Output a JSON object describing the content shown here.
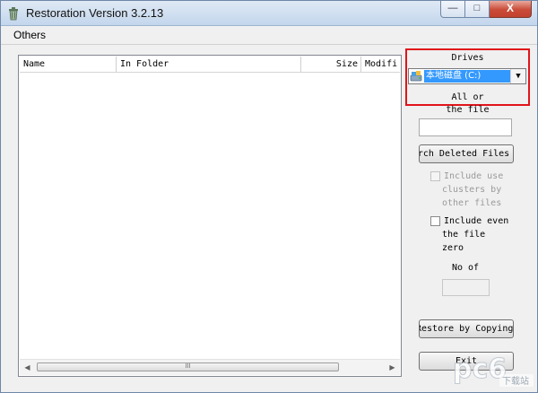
{
  "window": {
    "title": "Restoration Version 3.2.13"
  },
  "titlebar_buttons": {
    "minimize": "—",
    "maximize": "□",
    "close": "X"
  },
  "menu": {
    "items": [
      "Others"
    ]
  },
  "list": {
    "columns": [
      "Name",
      "In Folder",
      "Size",
      "Modifi"
    ],
    "scroll_left": "◀",
    "scroll_right": "▶",
    "thumb_grip": "III"
  },
  "drives": {
    "label": "Drives",
    "selected": "本地磁盘 (C:)",
    "dropdown_arrow": "▼"
  },
  "filter": {
    "label_line1": "All or",
    "label_line2": "the file",
    "value": ""
  },
  "search_button": {
    "label": "Search Deleted Files"
  },
  "options": {
    "include_clusters": {
      "line1": "Include use",
      "line2": "clusters by",
      "line3": "other files",
      "checked": false,
      "enabled": false
    },
    "include_zero": {
      "line1": "Include even",
      "line2": "the file",
      "line3": "zero",
      "checked": false,
      "enabled": true
    }
  },
  "count": {
    "label": "No of",
    "value": ""
  },
  "restore_button": {
    "label": "Restore by Copying"
  },
  "bottom_button": {
    "label": "Exit"
  },
  "watermark": {
    "text": "下载站"
  },
  "colors": {
    "selection": "#3399ff",
    "highlight_border": "#e0141b",
    "close_red": "#c94b38"
  }
}
